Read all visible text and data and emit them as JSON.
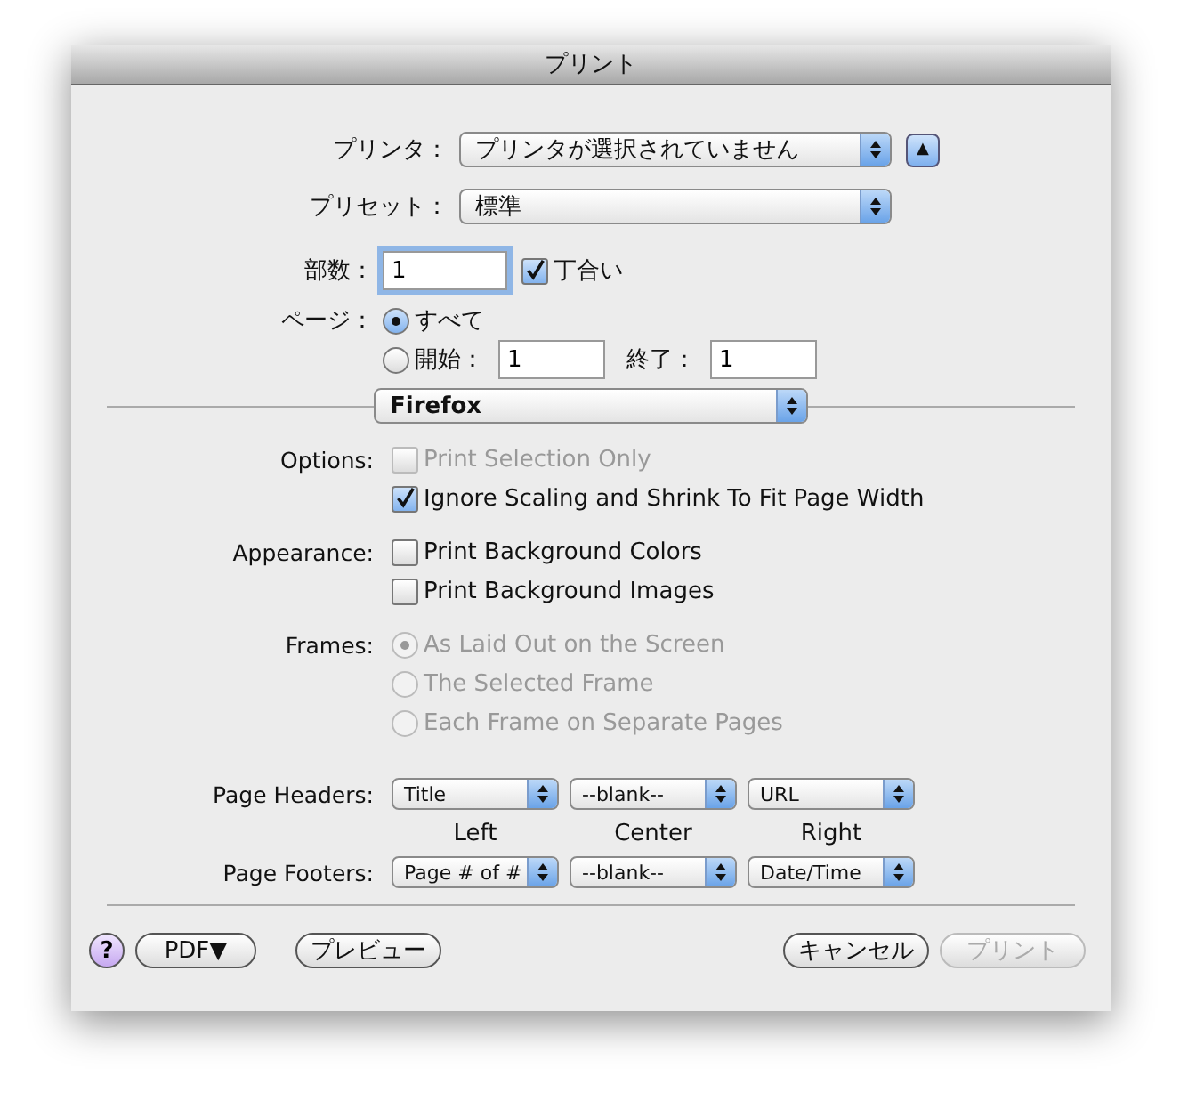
{
  "window": {
    "title": "プリント"
  },
  "printer": {
    "label": "プリンタ：",
    "value": "プリンタが選択されていません",
    "toggle": "▲"
  },
  "preset": {
    "label": "プリセット：",
    "value": "標準"
  },
  "copies": {
    "label": "部数：",
    "value": "1",
    "collate": {
      "label": "丁合い",
      "checked": true
    }
  },
  "pages": {
    "label": "ページ：",
    "options": [
      {
        "label": "すべて",
        "selected": true
      },
      {
        "label": "開始：",
        "selected": false
      }
    ],
    "from": "1",
    "to_label": "終了：",
    "to": "1"
  },
  "panel_menu": {
    "value": "Firefox"
  },
  "sections": [
    {
      "label": "Options:",
      "items": [
        {
          "kind": "checkbox",
          "label": "Print Selection Only",
          "checked": false,
          "disabled": true
        },
        {
          "kind": "checkbox",
          "label": "Ignore Scaling and Shrink To Fit Page Width",
          "checked": true,
          "disabled": false
        }
      ]
    },
    {
      "label": "Appearance:",
      "items": [
        {
          "kind": "checkbox",
          "label": "Print Background Colors",
          "checked": false,
          "disabled": false
        },
        {
          "kind": "checkbox",
          "label": "Print Background Images",
          "checked": false,
          "disabled": false
        }
      ]
    },
    {
      "label": "Frames:",
      "items": [
        {
          "kind": "radio",
          "label": "As Laid Out on the Screen",
          "selected": true,
          "disabled": true
        },
        {
          "kind": "radio",
          "label": "The Selected Frame",
          "selected": false,
          "disabled": true
        },
        {
          "kind": "radio",
          "label": "Each Frame on Separate Pages",
          "selected": false,
          "disabled": true
        }
      ]
    }
  ],
  "headers": {
    "label": "Page Headers:",
    "values": [
      "Title",
      "--blank--",
      "URL"
    ]
  },
  "positions": [
    "Left",
    "Center",
    "Right"
  ],
  "footers": {
    "label": "Page Footers:",
    "values": [
      "Page # of #",
      "--blank--",
      "Date/Time"
    ]
  },
  "buttons": {
    "help": "?",
    "pdf": "PDF▼",
    "preview": "プレビュー",
    "cancel": "キャンセル",
    "print": {
      "label": "プリント",
      "disabled": true
    }
  }
}
